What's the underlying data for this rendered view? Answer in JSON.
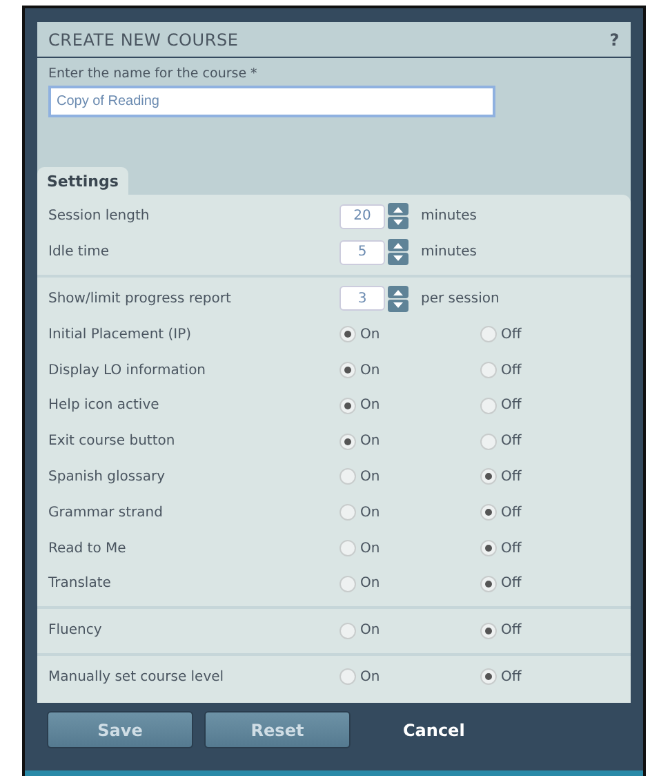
{
  "dialog": {
    "title": "CREATE NEW COURSE",
    "help": "?"
  },
  "name_field": {
    "label": "Enter the name for the course *",
    "value": "Copy of Reading"
  },
  "tabs": [
    {
      "label": "Settings",
      "selected": true
    }
  ],
  "settings": [
    [
      {
        "kind": "spinner",
        "label": "Session length",
        "value": "20",
        "unit": "minutes"
      },
      {
        "kind": "spinner",
        "label": "Idle time",
        "value": "5",
        "unit": "minutes"
      }
    ],
    [
      {
        "kind": "spinner",
        "label": "Show/limit progress report",
        "value": "3",
        "unit": "per session"
      },
      {
        "kind": "radio",
        "label": "Initial Placement (IP)",
        "options": [
          {
            "label": "On",
            "selected": true
          },
          {
            "label": "Off",
            "selected": false
          }
        ]
      },
      {
        "kind": "radio",
        "label": "Display LO information",
        "options": [
          {
            "label": "On",
            "selected": true
          },
          {
            "label": "Off",
            "selected": false
          }
        ]
      },
      {
        "kind": "radio",
        "label": "Help icon active",
        "options": [
          {
            "label": "On",
            "selected": true
          },
          {
            "label": "Off",
            "selected": false
          }
        ]
      },
      {
        "kind": "radio",
        "label": "Exit course button",
        "options": [
          {
            "label": "On",
            "selected": true
          },
          {
            "label": "Off",
            "selected": false
          }
        ]
      },
      {
        "kind": "radio",
        "label": "Spanish glossary",
        "options": [
          {
            "label": "On",
            "selected": false
          },
          {
            "label": "Off",
            "selected": true
          }
        ]
      },
      {
        "kind": "radio",
        "label": "Grammar strand",
        "options": [
          {
            "label": "On",
            "selected": false
          },
          {
            "label": "Off",
            "selected": true
          }
        ]
      },
      {
        "kind": "radio",
        "label": "Read to Me",
        "options": [
          {
            "label": "On",
            "selected": false
          },
          {
            "label": "Off",
            "selected": true
          }
        ]
      },
      {
        "kind": "radio",
        "label": "Translate",
        "options": [
          {
            "label": "On",
            "selected": false
          },
          {
            "label": "Off",
            "selected": true
          }
        ]
      }
    ],
    [
      {
        "kind": "radio",
        "label": "Fluency",
        "options": [
          {
            "label": "On",
            "selected": false
          },
          {
            "label": "Off",
            "selected": true
          }
        ]
      }
    ],
    [
      {
        "kind": "radio",
        "label": "Manually set course level",
        "options": [
          {
            "label": "On",
            "selected": false
          },
          {
            "label": "Off",
            "selected": true
          }
        ]
      }
    ]
  ],
  "buttons": [
    {
      "kind": "primary",
      "label": "Save"
    },
    {
      "kind": "primary",
      "label": "Reset"
    },
    {
      "kind": "link",
      "label": "Cancel"
    }
  ]
}
